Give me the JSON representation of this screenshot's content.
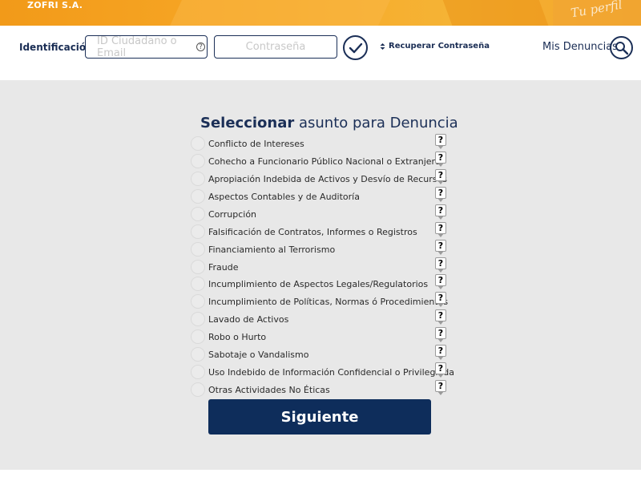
{
  "header": {
    "brand": "ZOFRI S.A.",
    "slogan": "Tu perfil"
  },
  "login": {
    "identification_label": "Identificación",
    "id_placeholder": "ID Ciudadano o Email",
    "password_placeholder": "Contraseña",
    "recover_label": "Recuperar Contraseña",
    "my_reports_label": "Mis Denuncias"
  },
  "form": {
    "title_bold": "Seleccionar",
    "title_rest": " asunto para Denuncia",
    "help_symbol": "?",
    "options": [
      {
        "label": "Conflicto de Intereses"
      },
      {
        "label": "Cohecho a Funcionario Público Nacional o Extranjero"
      },
      {
        "label": "Apropiación Indebida de Activos y Desvío de Recursos"
      },
      {
        "label": "Aspectos Contables y de Auditoría"
      },
      {
        "label": "Corrupción"
      },
      {
        "label": "Falsificación de Contratos, Informes o Registros"
      },
      {
        "label": "Financiamiento al Terrorismo"
      },
      {
        "label": "Fraude"
      },
      {
        "label": "Incumplimiento de Aspectos Legales/Regulatorios"
      },
      {
        "label": "Incumplimiento de Políticas, Normas ó Procedimientos"
      },
      {
        "label": "Lavado de Activos"
      },
      {
        "label": "Robo o Hurto"
      },
      {
        "label": "Sabotaje o Vandalismo"
      },
      {
        "label": "Uso Indebido de Información Confidencial o Privilegiada"
      },
      {
        "label": "Otras Actividades No Éticas"
      }
    ],
    "next_label": "Siguiente"
  },
  "colors": {
    "navy": "#0e2d5b",
    "banner_orange": "#f29a19",
    "background_gray": "#e8e8e8"
  }
}
